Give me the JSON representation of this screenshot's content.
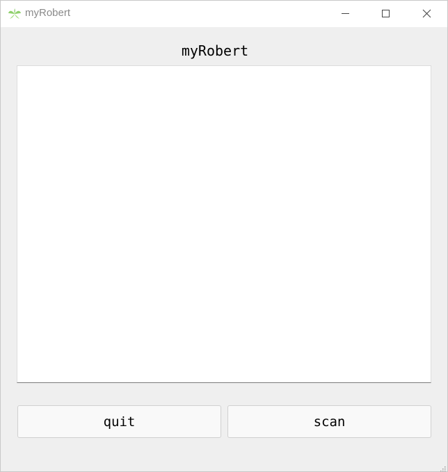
{
  "window": {
    "title": "myRobert"
  },
  "main": {
    "heading": "myRobert",
    "output_text": ""
  },
  "buttons": {
    "quit_label": "quit",
    "scan_label": "scan"
  },
  "icons": {
    "app": "leaf-app-icon",
    "minimize": "minimize-icon",
    "maximize": "maximize-icon",
    "close": "close-icon",
    "grip": "size-grip-icon"
  },
  "colors": {
    "window_bg": "#efefef",
    "titlebar_bg": "#ffffff",
    "title_text": "#8a8a8a",
    "app_icon": "#8fd06b"
  }
}
